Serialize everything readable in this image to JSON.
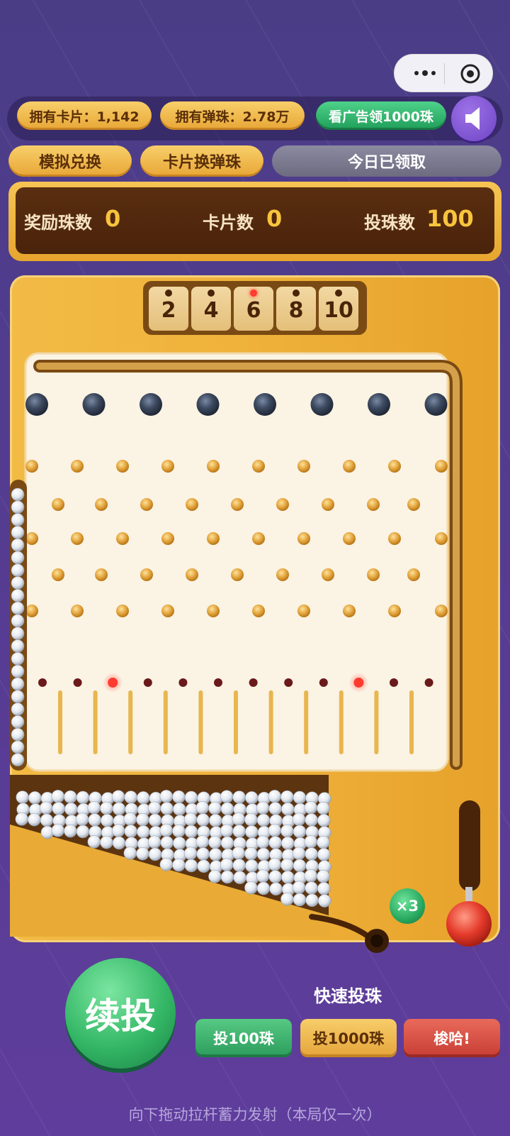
{
  "header": {
    "cards_owned": "拥有卡片：1,142",
    "marbles_owned": "拥有弹珠：2.78万",
    "ad_reward": "看广告领1000珠",
    "icons": {
      "menu": "more-dots-icon",
      "close": "target-close-icon",
      "sound": "speaker-icon"
    }
  },
  "actions": {
    "simulate_exchange": "模拟兑换",
    "card_to_marbles": "卡片换弹珠",
    "daily_status": "今日已领取"
  },
  "scoreboard": {
    "reward_label": "奖励珠数",
    "reward_value": "0",
    "cards_label": "卡片数",
    "cards_value": "0",
    "throw_label": "投珠数",
    "throw_value": "100"
  },
  "machine": {
    "multipliers": [
      "2",
      "4",
      "6",
      "8",
      "10"
    ],
    "active_multiplier": "6",
    "bonus_badge": "×3",
    "colors": {
      "gold": "#efb13a",
      "board": "#fbf3e4",
      "peg": "#e2a23a",
      "bumper": "#3a475c",
      "active": "#ff3b30"
    }
  },
  "controls": {
    "continue_button": "续投",
    "quick_title": "快速投珠",
    "throw_100": "投100珠",
    "throw_1000": "投1000珠",
    "go_button": "梭哈!",
    "hint": "向下拖动拉杆蓄力发射（本局仅一次）"
  }
}
